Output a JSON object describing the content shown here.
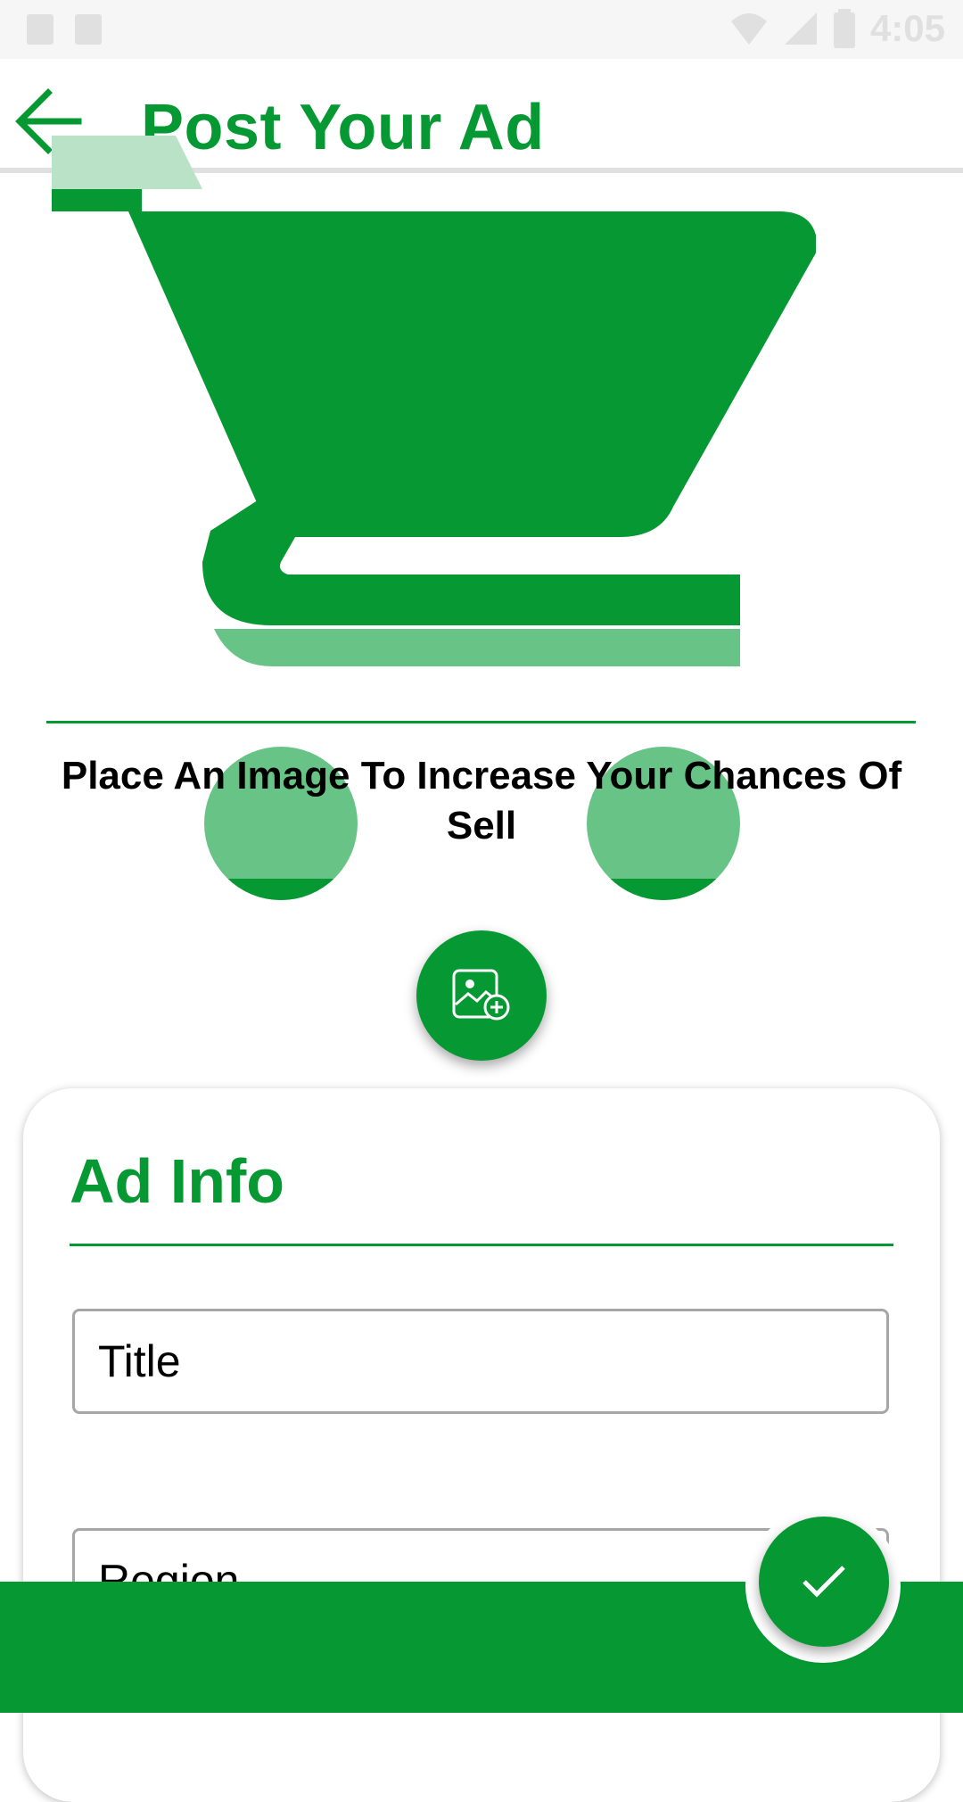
{
  "status_bar": {
    "time": "4:05",
    "icons": [
      "image-icon",
      "sim-icon",
      "wifi-icon",
      "signal-icon",
      "battery-icon"
    ]
  },
  "toolbar": {
    "title": "Post Your Ad",
    "back_icon": "arrow-left-icon"
  },
  "hero": {
    "illustration": "shopping-cart-icon",
    "caption": "Place An Image To Increase Your Chances Of Sell"
  },
  "add_image": {
    "icon": "add-photo-icon"
  },
  "ad_info": {
    "title": "Ad Info",
    "fields": {
      "title": {
        "placeholder": "Title",
        "value": ""
      },
      "region": {
        "placeholder": "Region",
        "value": ""
      }
    }
  },
  "submit": {
    "icon": "check-icon"
  },
  "colors": {
    "primary": "#069833",
    "primary_light": "#67c386",
    "primary_pale": "#b9e2c6",
    "divider": "#e0e0e0"
  }
}
